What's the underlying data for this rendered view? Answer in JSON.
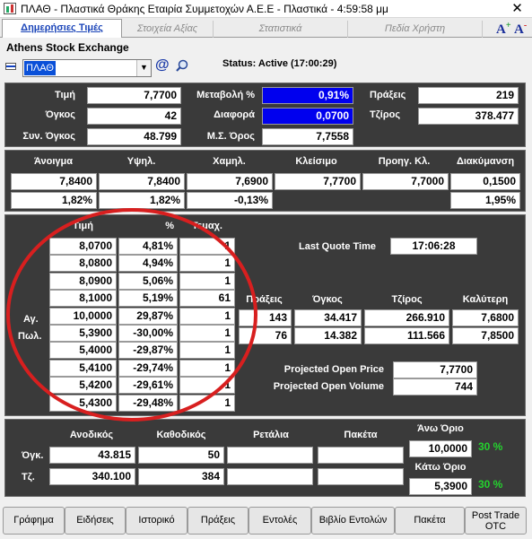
{
  "window": {
    "title": "ΠΛΑΘ - Πλαστικά Θράκης Εταιρία Συμμετοχών Α.Ε.Ε - Πλαστικά - 4:59:58 μμ",
    "close": "✕"
  },
  "tabs": [
    "Δημερήσιες Τιμές",
    "Στοιχεία Αξίας",
    "Στατιστικά",
    "Πεδία Χρήστη"
  ],
  "font_buttons": [
    "A",
    "A"
  ],
  "header": {
    "exchange": "Athens Stock Exchange",
    "symbol": "ΠΛΑΘ",
    "at": "@",
    "status": "Status: Active (17:00:29)"
  },
  "quote": {
    "price_label": "Τιμή",
    "price": "7,7700",
    "volume_label": "Όγκος",
    "volume": "42",
    "total_volume_label": "Συν. Όγκος",
    "total_volume": "48.799",
    "change_pct_label": "Μεταβολή %",
    "change_pct": "0,91%",
    "diff_label": "Διαφορά",
    "diff": "0,0700",
    "avg_label": "Μ.Σ. Όρος",
    "avg": "7,7558",
    "trades_label": "Πράξεις",
    "trades": "219",
    "turnover_label": "Τζίρος",
    "turnover": "378.477"
  },
  "session": {
    "headers": [
      "Άνοιγμα",
      "Υψηλ.",
      "Χαμηλ.",
      "Κλείσιμο",
      "Προηγ. Κλ.",
      "Διακύμανση"
    ],
    "values": [
      "7,8400",
      "7,8400",
      "7,6900",
      "7,7700",
      "7,7000",
      "0,1500"
    ],
    "percents": [
      "1,82%",
      "1,82%",
      "-0,13%",
      "",
      "",
      "1,95%"
    ]
  },
  "depth": {
    "headers": [
      "Τιμή",
      "%",
      "Τεμαχ."
    ],
    "rows": [
      {
        "price": "8,0700",
        "pct": "4,81%",
        "qty": "1"
      },
      {
        "price": "8,0800",
        "pct": "4,94%",
        "qty": "1"
      },
      {
        "price": "8,0900",
        "pct": "5,06%",
        "qty": "1"
      },
      {
        "price": "8,1000",
        "pct": "5,19%",
        "qty": "61"
      },
      {
        "price": "10,0000",
        "pct": "29,87%",
        "qty": "1"
      },
      {
        "price": "5,3900",
        "pct": "-30,00%",
        "qty": "1"
      },
      {
        "price": "5,4000",
        "pct": "-29,87%",
        "qty": "1"
      },
      {
        "price": "5,4100",
        "pct": "-29,74%",
        "qty": "1"
      },
      {
        "price": "5,4200",
        "pct": "-29,61%",
        "qty": "1"
      },
      {
        "price": "5,4300",
        "pct": "-29,48%",
        "qty": "1"
      }
    ],
    "buy_label": "Αγ.",
    "sell_label": "Πωλ.",
    "last_quote_label": "Last Quote Time",
    "last_quote_time": "17:06:28",
    "side_headers": [
      "Πράξεις",
      "Όγκος",
      "Τζίρος",
      "Καλύτερη"
    ],
    "buy_stats": [
      "143",
      "34.417",
      "266.910",
      "7,6800"
    ],
    "sell_stats": [
      "76",
      "14.382",
      "111.566",
      "7,8500"
    ],
    "proj_price_label": "Projected Open Price",
    "proj_price": "7,7700",
    "proj_volume_label": "Projected Open Volume",
    "proj_volume": "744"
  },
  "totals": {
    "headers": [
      "Ανοδικός",
      "Καθοδικός",
      "Ρετάλια",
      "Πακέτα"
    ],
    "vol_label": "Όγκ.",
    "vol": [
      "43.815",
      "50",
      "",
      ""
    ],
    "turn_label": "Τζ.",
    "turn": [
      "340.100",
      "384",
      "",
      ""
    ],
    "upper_label": "Άνω Όριο",
    "upper": "10,0000",
    "upper_pct": "30 %",
    "lower_label": "Κάτω Όριο",
    "lower": "5,3900",
    "lower_pct": "30 %"
  },
  "buttons": [
    "Γράφημα",
    "Ειδήσεις",
    "Ιστορικό",
    "Πράξεις",
    "Εντολές",
    "Βιβλίο Εντολών",
    "Πακέτα"
  ],
  "post_trade": [
    "Post Trade",
    "OTC"
  ],
  "colors": {
    "panel": "#3a3a3a",
    "blue_value": "#0000ee",
    "green": "#24d22e",
    "annotation": "#d81f1f"
  }
}
